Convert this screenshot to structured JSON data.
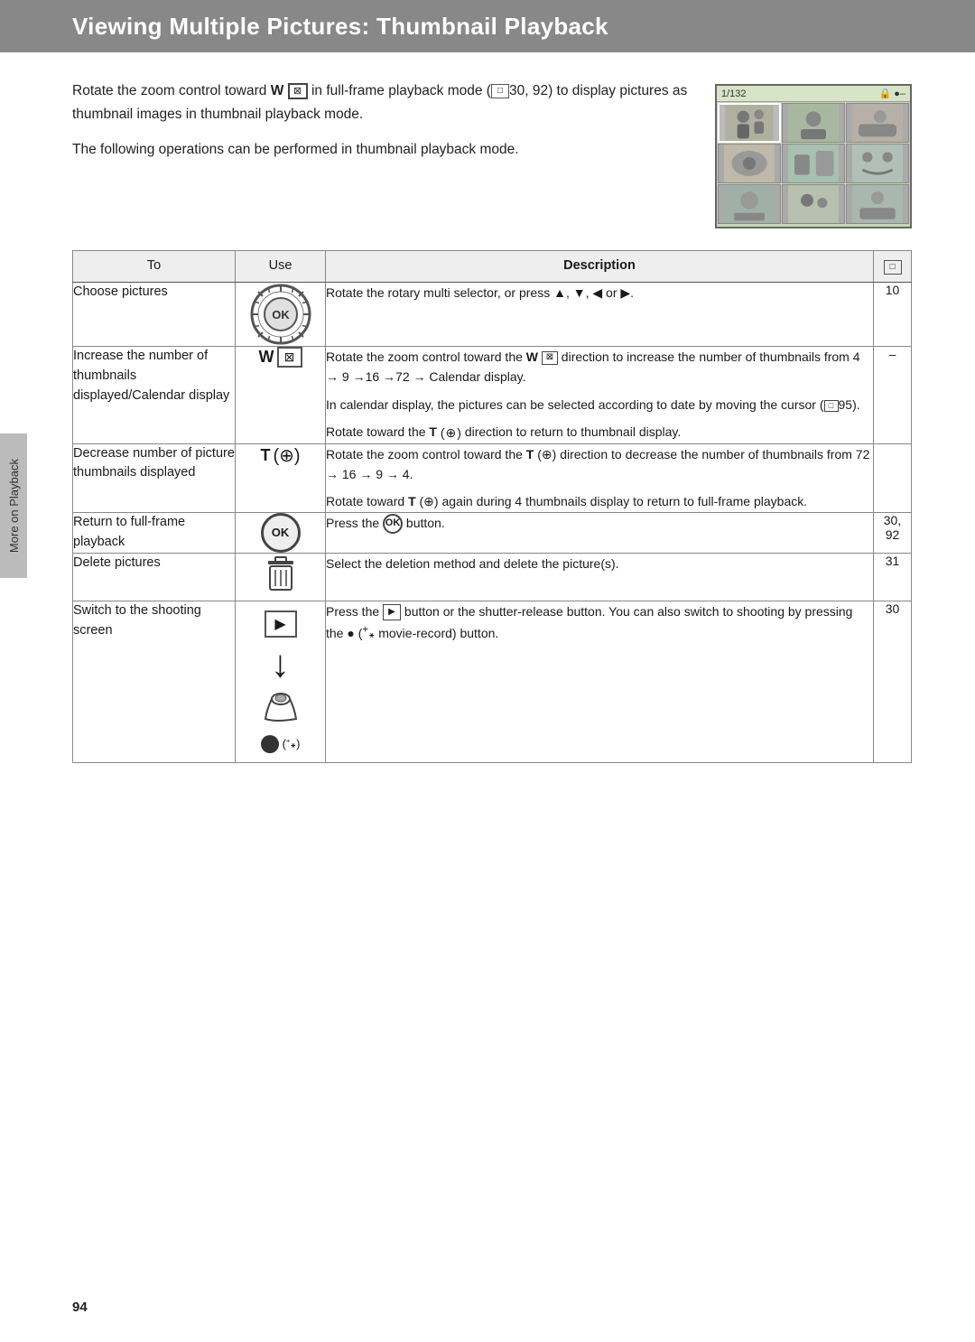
{
  "header": {
    "title": "Viewing Multiple Pictures: Thumbnail Playback",
    "bg_color": "#888888"
  },
  "sidebar": {
    "label": "More on Playback"
  },
  "intro": {
    "paragraph1": "Rotate the zoom control toward",
    "bold1": "W",
    "paragraph1b": "in full-frame playback mode (",
    "ref1": "30, 92",
    "paragraph1c": ") to display pictures as thumbnail images in thumbnail playback mode.",
    "paragraph2": "The following operations can be performed in thumbnail playback mode."
  },
  "table": {
    "headers": {
      "to": "To",
      "use": "Use",
      "description": "Description",
      "page": "□"
    },
    "rows": [
      {
        "to": "Choose pictures",
        "use": "ok_rotary",
        "description": "Rotate the rotary multi selector, or press ▲, ▼, ◀ or ▶.",
        "page": "10"
      },
      {
        "to": "Increase the number of thumbnails displayed/Calendar display",
        "use": "w_button",
        "description": "Rotate the zoom control toward the W (⊠) direction to increase the number of thumbnails from 4 → 9 →16 →72 → Calendar display.\nIn calendar display, the pictures can be selected according to date by moving the cursor (□95).\nRotate toward the T (⊕) direction to return to thumbnail display.",
        "page": "–"
      },
      {
        "to": "Decrease number of picture thumbnails displayed",
        "use": "t_button",
        "description": "Rotate the zoom control toward the T (⊕) direction to decrease the number of thumbnails from 72 → 16 → 9 → 4.\nRotate toward T (⊕) again during 4 thumbnails display to return to full-frame playback.",
        "page": ""
      },
      {
        "to": "Return to full-frame playback",
        "use": "ok_button",
        "description": "Press the ⊛ button.",
        "page": "30,\n92"
      },
      {
        "to": "Delete pictures",
        "use": "delete_icon",
        "description": "Select the deletion method and delete the picture(s).",
        "page": "31"
      },
      {
        "to": "Switch to the shooting screen",
        "use": "multi_icons",
        "description": "Press the ▶ button or the shutter-release button. You can also switch to shooting by pressing the ● (⁺꘎ movie-record) button.",
        "page": "30"
      }
    ]
  },
  "page_number": "94"
}
